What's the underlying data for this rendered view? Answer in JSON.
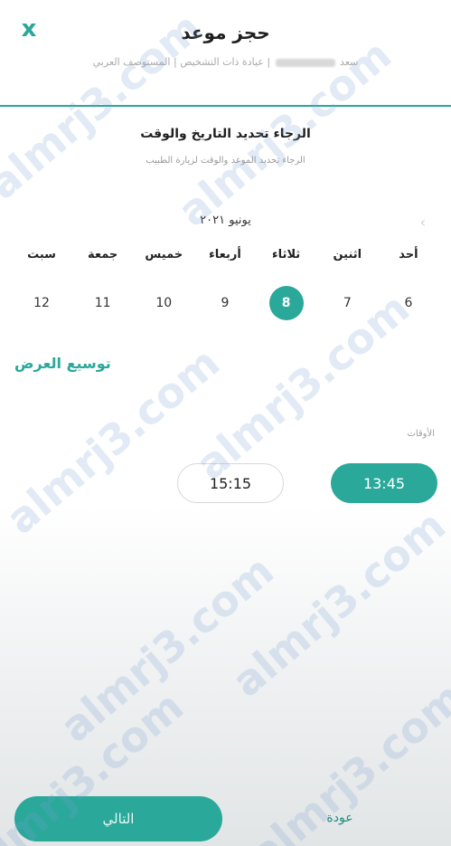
{
  "header": {
    "title": "حجز موعد",
    "breadcrumb_part1": "سعد",
    "breadcrumb_part2": "عيادة ذات التشخيص",
    "breadcrumb_part3": "المستوصف العربي",
    "separator": "|",
    "close_icon": "x"
  },
  "instruction": {
    "title": "الرجاء تحديد التاريخ والوقت",
    "subtitle": "الرجاء تحديد الموعد والوقت لزيارة الطبيب"
  },
  "calendar": {
    "month": "يونيو ٢٠٢١",
    "prev_icon": "‹",
    "days": [
      {
        "name": "أحد",
        "num": "6"
      },
      {
        "name": "اثنين",
        "num": "7"
      },
      {
        "name": "ثلاثاء",
        "num": "8",
        "selected": true
      },
      {
        "name": "أربعاء",
        "num": "9"
      },
      {
        "name": "خميس",
        "num": "10"
      },
      {
        "name": "جمعة",
        "num": "11"
      },
      {
        "name": "سبت",
        "num": "12"
      }
    ]
  },
  "expand_label": "توسيع العرض",
  "times": {
    "label": "الأوقات",
    "slots": [
      {
        "time": "13:45",
        "selected": true
      },
      {
        "time": "15:15",
        "selected": false
      }
    ]
  },
  "footer": {
    "next_label": "التالي",
    "back_label": "عودة"
  },
  "watermark": "almrj3.com",
  "colors": {
    "accent": "#2aa89a",
    "text": "#1f1f1f",
    "muted": "#9a9a9a"
  }
}
